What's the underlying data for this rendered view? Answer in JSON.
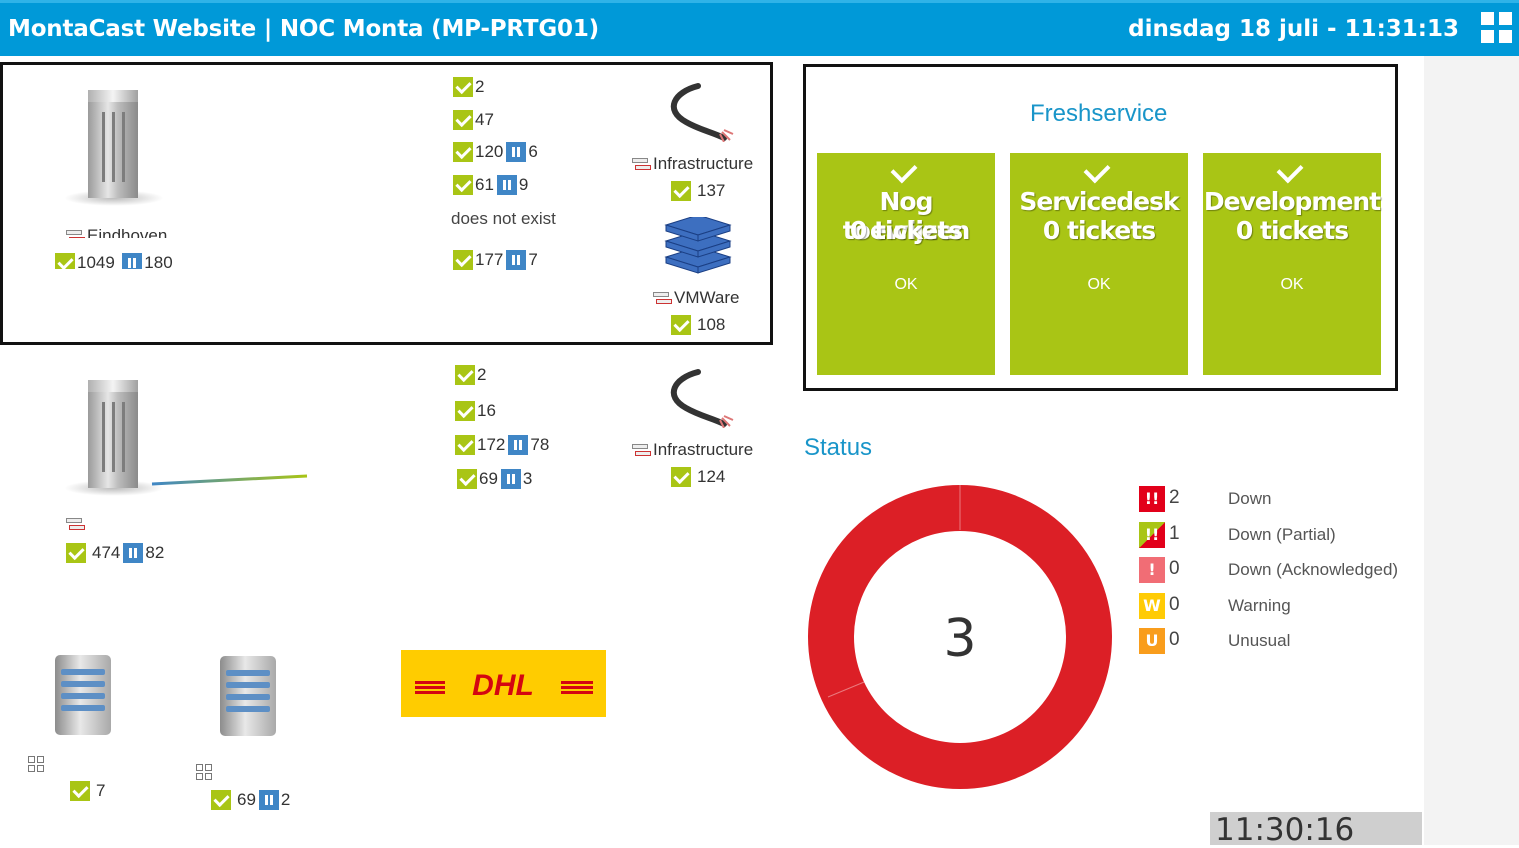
{
  "header": {
    "title": "MontaCast Website | NOC Monta (MP-PRTG01)",
    "datetime": "dinsdag 18 juli - 11:31:13",
    "menu_icon": "grid-icon"
  },
  "map": {
    "site1": {
      "label": "Eindhoven",
      "counts": {
        "ok": "1049",
        "paused": "180"
      },
      "rows": [
        {
          "ok": "2"
        },
        {
          "ok": "47"
        },
        {
          "ok": "120",
          "paused": "6"
        },
        {
          "ok": "61",
          "paused": "9"
        },
        {
          "text": "does not exist"
        },
        {
          "ok": "177",
          "paused": "7"
        }
      ],
      "infrastructure": {
        "label": "Infrastructure",
        "ok": "137"
      },
      "vmware": {
        "label": "VMWare",
        "ok": "108"
      }
    },
    "site2": {
      "counts": {
        "ok": "474",
        "paused": "82"
      },
      "rows": [
        {
          "ok": "2"
        },
        {
          "ok": "16"
        },
        {
          "ok": "172",
          "paused": "78"
        },
        {
          "ok": "69",
          "paused": "3"
        }
      ],
      "infrastructure": {
        "label": "Infrastructure",
        "ok": "124"
      }
    },
    "server1": {
      "ok": "7"
    },
    "server2": {
      "ok": "69",
      "paused": "2"
    },
    "dhl_logo": "DHL"
  },
  "freshservice": {
    "title": "Freshservice",
    "tiles": [
      {
        "name": "Nog toewijzen",
        "tickets": "0 tickets",
        "status": "OK"
      },
      {
        "name": "Servicedesk",
        "tickets": "0 tickets",
        "status": "OK"
      },
      {
        "name": "Development",
        "tickets": "0 tickets",
        "status": "OK"
      }
    ],
    "tile_color": "#a9c515"
  },
  "status": {
    "title": "Status",
    "total": "3",
    "legend": [
      {
        "badge": "!!",
        "count": "2",
        "label": "Down",
        "color": "#e2001a"
      },
      {
        "badge": "!!",
        "count": "1",
        "label": "Down (Partial)",
        "color": "#e2001a"
      },
      {
        "badge": "!",
        "count": "0",
        "label": "Down (Acknowledged)",
        "color": "#f16d75"
      },
      {
        "badge": "W",
        "count": "0",
        "label": "Warning",
        "color": "#ffcb05"
      },
      {
        "badge": "U",
        "count": "0",
        "label": "Unusual",
        "color": "#f99d1c"
      }
    ]
  },
  "clock": "11:30:16"
}
